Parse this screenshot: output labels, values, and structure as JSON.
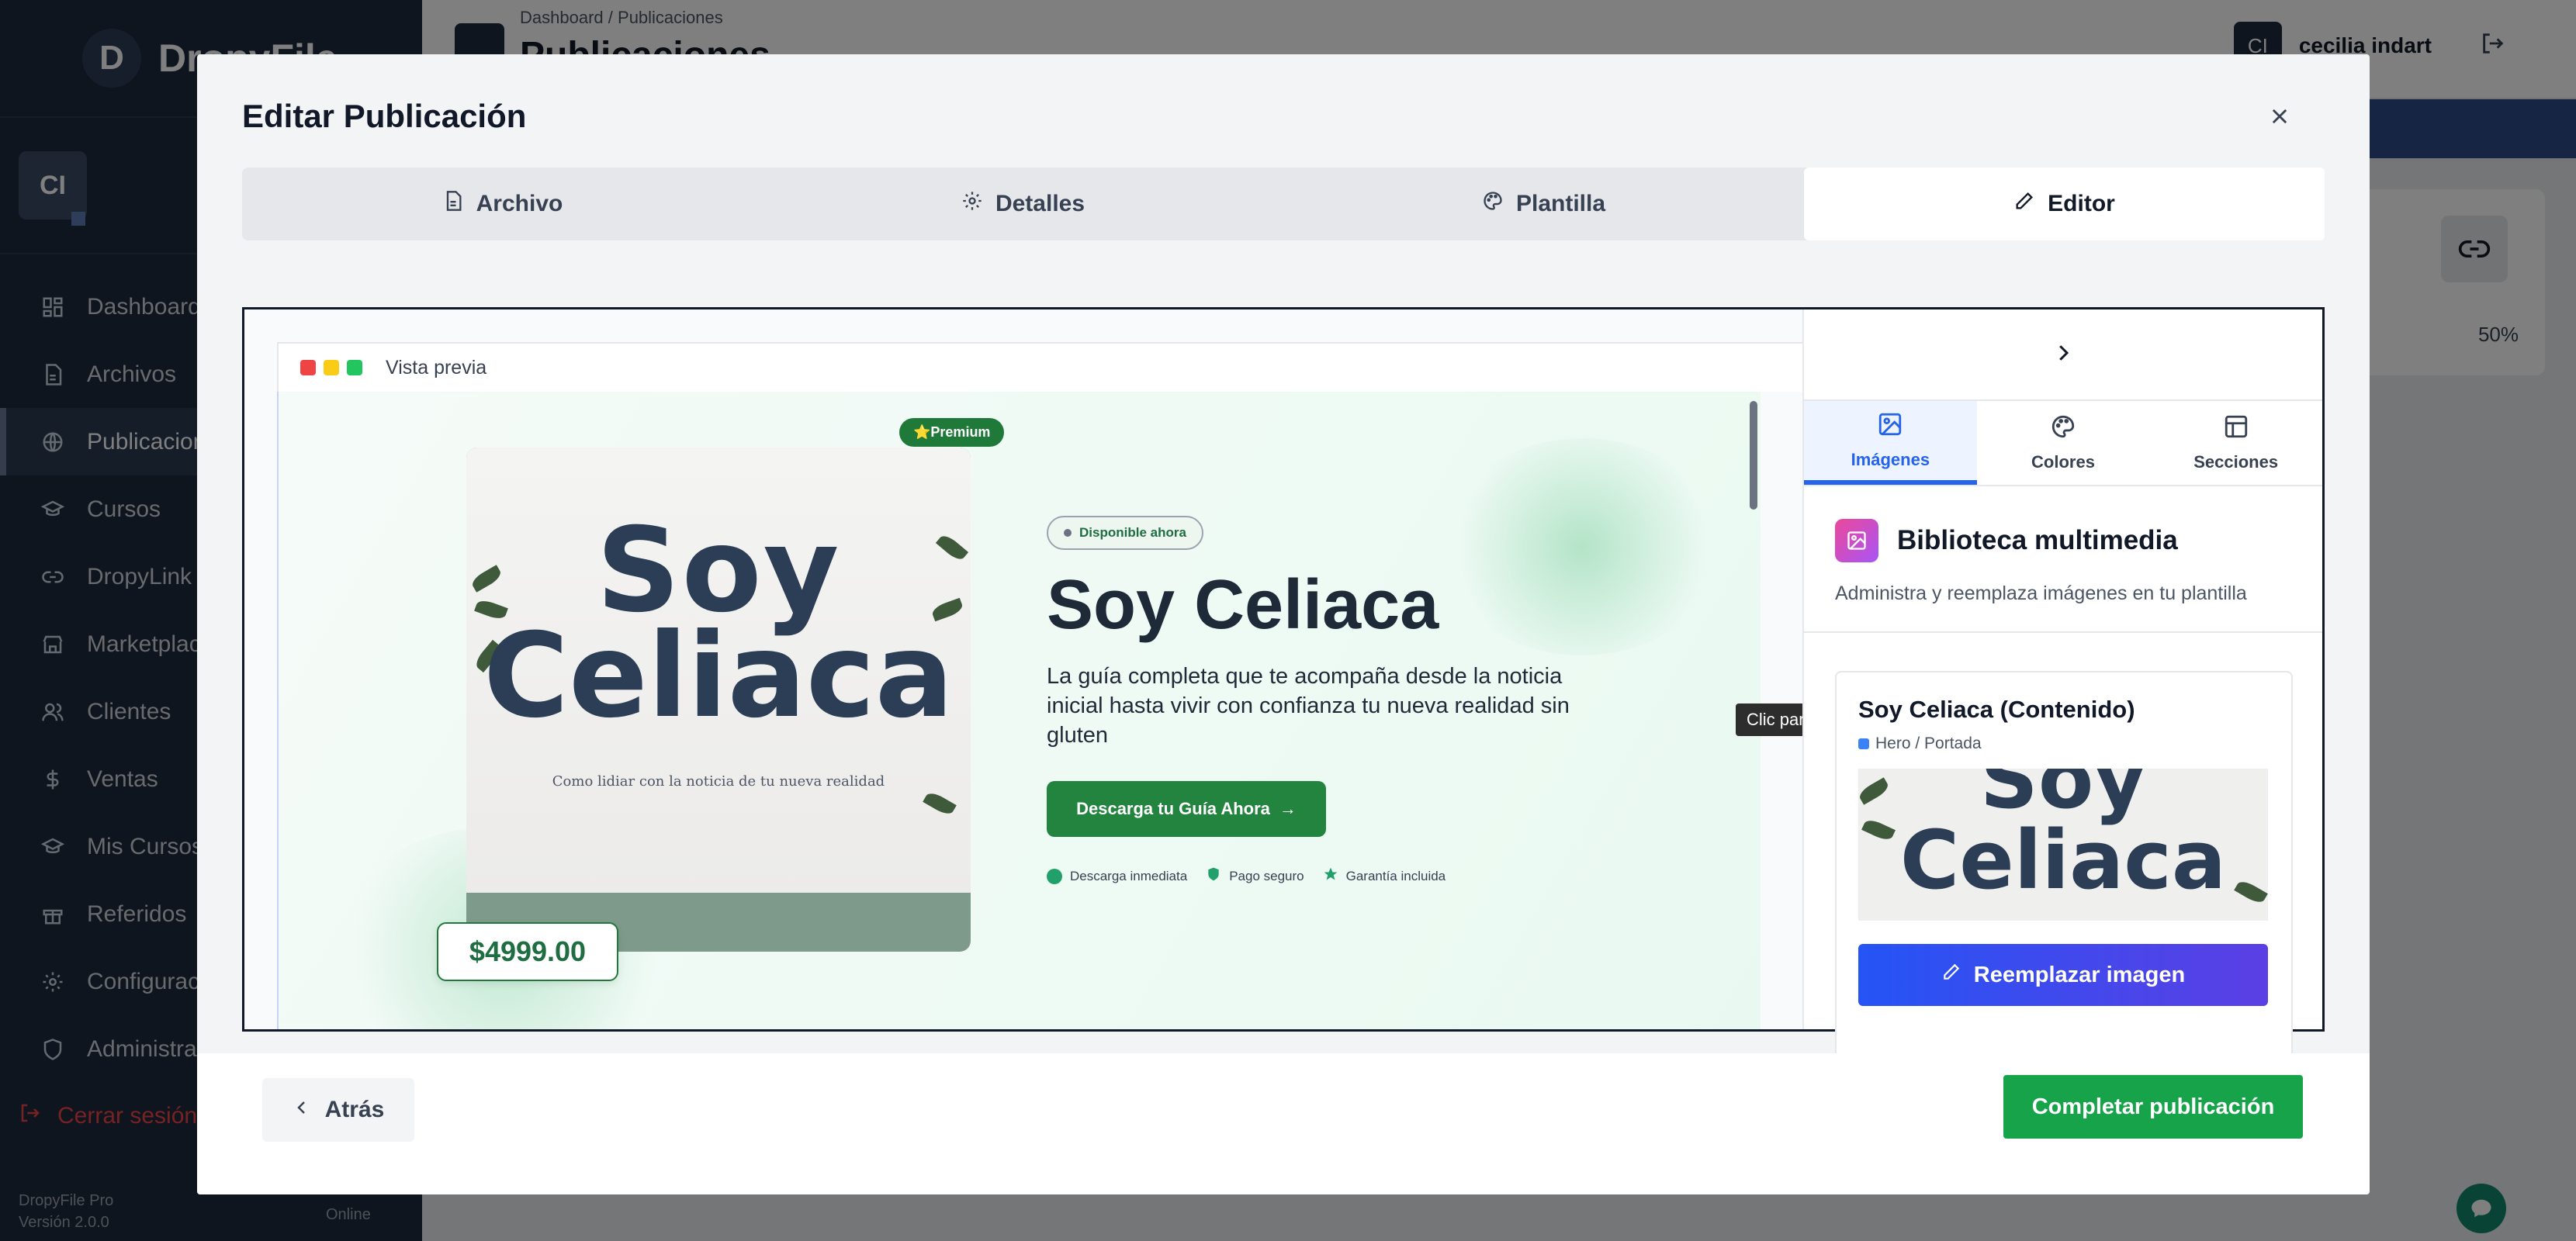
{
  "app": {
    "brand": "DropyFile",
    "user_initials": "CI",
    "user_name": "cecilia indart",
    "version_name": "DropyFile Pro",
    "version": "Versión 2.0.0",
    "online": "Online",
    "logout": "Cerrar sesión"
  },
  "sidebar": {
    "items": [
      {
        "label": "Dashboard",
        "icon": "dashboard-icon"
      },
      {
        "label": "Archivos",
        "icon": "file-icon"
      },
      {
        "label": "Publicaciones",
        "icon": "globe-icon"
      },
      {
        "label": "Cursos",
        "icon": "graduation-cap-icon"
      },
      {
        "label": "DropyLink",
        "icon": "link-icon"
      },
      {
        "label": "Marketplace",
        "icon": "store-icon"
      },
      {
        "label": "Clientes",
        "icon": "users-icon"
      },
      {
        "label": "Ventas",
        "icon": "dollar-icon"
      },
      {
        "label": "Mis Cursos",
        "icon": "graduation-cap-icon"
      },
      {
        "label": "Referidos",
        "icon": "gift-icon"
      },
      {
        "label": "Configuración",
        "icon": "gear-icon"
      },
      {
        "label": "Administración",
        "icon": "shield-icon"
      }
    ]
  },
  "topbar": {
    "breadcrumb_root": "Dashboard",
    "breadcrumb_sep": "/",
    "breadcrumb_current": "Publicaciones",
    "title": "Publicaciones"
  },
  "background": {
    "progress_label": "50%"
  },
  "modal": {
    "title": "Editar Publicación",
    "tabs": [
      {
        "label": "Archivo",
        "icon": "document-icon"
      },
      {
        "label": "Detalles",
        "icon": "gear-icon"
      },
      {
        "label": "Plantilla",
        "icon": "palette-icon"
      },
      {
        "label": "Editor",
        "icon": "pencil-icon",
        "active": true
      }
    ],
    "back_label": "Atrás",
    "complete_label": "Completar publicación"
  },
  "preview": {
    "bar_label": "Vista previa",
    "cover_line1": "Soy",
    "cover_line2": "Celiaca",
    "cover_subtitle": "Como lidiar con la noticia de tu nueva realidad",
    "premium": "⭐Premium",
    "price": "$4999.00",
    "badge": "Disponible ahora",
    "heading": "Soy Celiaca",
    "description": "La guía completa que te acompaña desde la noticia inicial hasta vivir con confianza tu nueva realidad sin gluten",
    "cta": "Descarga tu Guía Ahora",
    "cta_arrow": "→",
    "trust": [
      "Descarga inmediata",
      "Pago seguro",
      "Garantía incluida"
    ],
    "tooltip": "Clic para editar texto"
  },
  "panel": {
    "tabs": [
      {
        "label": "Imágenes",
        "icon": "image-icon",
        "active": true
      },
      {
        "label": "Colores",
        "icon": "palette-icon"
      },
      {
        "label": "Secciones",
        "icon": "layout-icon"
      }
    ],
    "library_title": "Biblioteca multimedia",
    "library_subtitle": "Administra y reemplaza imágenes en tu plantilla",
    "card_title": "Soy Celiaca (Contenido)",
    "card_tag": "Hero / Portada",
    "card_image_text": "Soy Celiaca",
    "replace_label": "Reemplazar imagen"
  },
  "colors": {
    "accent_blue": "#2563eb",
    "brand_green": "#22843f",
    "complete_green": "#16a34a",
    "sidebar_bg": "#1f2b3e",
    "logout_red": "#ef4444"
  }
}
